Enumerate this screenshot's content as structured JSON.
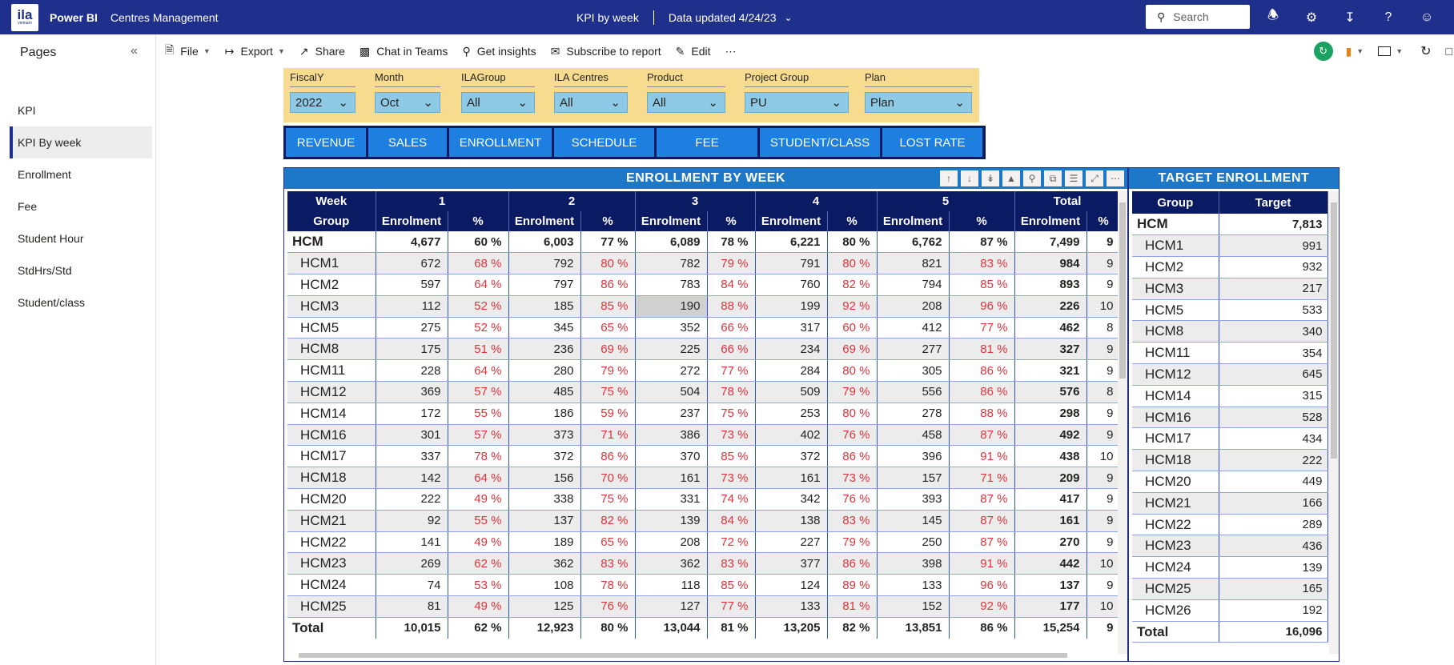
{
  "topbar": {
    "logo_text": "ila",
    "logo_sub": "vietnam",
    "brand": "Power BI",
    "workspace": "Centres Management",
    "report_title": "KPI by week",
    "data_updated": "Data updated 4/24/23",
    "search_placeholder": "Search"
  },
  "pages": {
    "title": "Pages",
    "items": [
      "KPI",
      "KPI By week",
      "Enrollment",
      "Fee",
      "Student Hour",
      "StdHrs/Std",
      "Student/class"
    ],
    "active_index": 1
  },
  "actions": {
    "file": "File",
    "export": "Export",
    "share": "Share",
    "chat": "Chat in Teams",
    "insights": "Get insights",
    "subscribe": "Subscribe to report",
    "edit": "Edit"
  },
  "slicers": [
    {
      "label": "FiscalY",
      "value": "2022"
    },
    {
      "label": "Month",
      "value": "Oct"
    },
    {
      "label": "ILAGroup",
      "value": "All"
    },
    {
      "label": "ILA Centres",
      "value": "All"
    },
    {
      "label": "Product",
      "value": "All"
    },
    {
      "label": "Project Group",
      "value": "PU"
    },
    {
      "label": "Plan",
      "value": "Plan"
    }
  ],
  "nav_buttons": [
    "REVENUE",
    "SALES",
    "ENROLLMENT",
    "SCHEDULE",
    "FEE",
    "STUDENT/CLASS",
    "LOST RATE"
  ],
  "enrollment": {
    "title": "ENROLLMENT BY WEEK",
    "week_label": "Week",
    "group_label": "Group",
    "weeks": [
      "1",
      "2",
      "3",
      "4",
      "5",
      "Total"
    ],
    "col_enrol": "Enrolment",
    "col_pct": "%",
    "rows": [
      {
        "g": "HCM",
        "v": [
          "4,677",
          "60 %",
          "6,003",
          "77 %",
          "6,089",
          "78 %",
          "6,221",
          "80 %",
          "6,762",
          "87 %",
          "7,499",
          "9"
        ]
      },
      {
        "g": "HCM1",
        "v": [
          "672",
          "68 %",
          "792",
          "80 %",
          "782",
          "79 %",
          "791",
          "80 %",
          "821",
          "83 %",
          "984",
          "9"
        ]
      },
      {
        "g": "HCM2",
        "v": [
          "597",
          "64 %",
          "797",
          "86 %",
          "783",
          "84 %",
          "760",
          "82 %",
          "794",
          "85 %",
          "893",
          "9"
        ]
      },
      {
        "g": "HCM3",
        "v": [
          "112",
          "52 %",
          "185",
          "85 %",
          "190",
          "88 %",
          "199",
          "92 %",
          "208",
          "96 %",
          "226",
          "10"
        ]
      },
      {
        "g": "HCM5",
        "v": [
          "275",
          "52 %",
          "345",
          "65 %",
          "352",
          "66 %",
          "317",
          "60 %",
          "412",
          "77 %",
          "462",
          "8"
        ]
      },
      {
        "g": "HCM8",
        "v": [
          "175",
          "51 %",
          "236",
          "69 %",
          "225",
          "66 %",
          "234",
          "69 %",
          "277",
          "81 %",
          "327",
          "9"
        ]
      },
      {
        "g": "HCM11",
        "v": [
          "228",
          "64 %",
          "280",
          "79 %",
          "272",
          "77 %",
          "284",
          "80 %",
          "305",
          "86 %",
          "321",
          "9"
        ]
      },
      {
        "g": "HCM12",
        "v": [
          "369",
          "57 %",
          "485",
          "75 %",
          "504",
          "78 %",
          "509",
          "79 %",
          "556",
          "86 %",
          "576",
          "8"
        ]
      },
      {
        "g": "HCM14",
        "v": [
          "172",
          "55 %",
          "186",
          "59 %",
          "237",
          "75 %",
          "253",
          "80 %",
          "278",
          "88 %",
          "298",
          "9"
        ]
      },
      {
        "g": "HCM16",
        "v": [
          "301",
          "57 %",
          "373",
          "71 %",
          "386",
          "73 %",
          "402",
          "76 %",
          "458",
          "87 %",
          "492",
          "9"
        ]
      },
      {
        "g": "HCM17",
        "v": [
          "337",
          "78 %",
          "372",
          "86 %",
          "370",
          "85 %",
          "372",
          "86 %",
          "396",
          "91 %",
          "438",
          "10"
        ]
      },
      {
        "g": "HCM18",
        "v": [
          "142",
          "64 %",
          "156",
          "70 %",
          "161",
          "73 %",
          "161",
          "73 %",
          "157",
          "71 %",
          "209",
          "9"
        ]
      },
      {
        "g": "HCM20",
        "v": [
          "222",
          "49 %",
          "338",
          "75 %",
          "331",
          "74 %",
          "342",
          "76 %",
          "393",
          "87 %",
          "417",
          "9"
        ]
      },
      {
        "g": "HCM21",
        "v": [
          "92",
          "55 %",
          "137",
          "82 %",
          "139",
          "84 %",
          "138",
          "83 %",
          "145",
          "87 %",
          "161",
          "9"
        ]
      },
      {
        "g": "HCM22",
        "v": [
          "141",
          "49 %",
          "189",
          "65 %",
          "208",
          "72 %",
          "227",
          "79 %",
          "250",
          "87 %",
          "270",
          "9"
        ]
      },
      {
        "g": "HCM23",
        "v": [
          "269",
          "62 %",
          "362",
          "83 %",
          "362",
          "83 %",
          "377",
          "86 %",
          "398",
          "91 %",
          "442",
          "10"
        ]
      },
      {
        "g": "HCM24",
        "v": [
          "74",
          "53 %",
          "108",
          "78 %",
          "118",
          "85 %",
          "124",
          "89 %",
          "133",
          "96 %",
          "137",
          "9"
        ]
      },
      {
        "g": "HCM25",
        "v": [
          "81",
          "49 %",
          "125",
          "76 %",
          "127",
          "77 %",
          "133",
          "81 %",
          "152",
          "92 %",
          "177",
          "10"
        ]
      }
    ],
    "total": {
      "g": "Total",
      "v": [
        "10,015",
        "62 %",
        "12,923",
        "80 %",
        "13,044",
        "81 %",
        "13,205",
        "82 %",
        "13,851",
        "86 %",
        "15,254",
        "9"
      ]
    }
  },
  "target": {
    "title": "TARGET ENROLLMENT",
    "group_label": "Group",
    "target_label": "Target",
    "rows": [
      {
        "g": "HCM",
        "t": "7,813"
      },
      {
        "g": "HCM1",
        "t": "991"
      },
      {
        "g": "HCM2",
        "t": "932"
      },
      {
        "g": "HCM3",
        "t": "217"
      },
      {
        "g": "HCM5",
        "t": "533"
      },
      {
        "g": "HCM8",
        "t": "340"
      },
      {
        "g": "HCM11",
        "t": "354"
      },
      {
        "g": "HCM12",
        "t": "645"
      },
      {
        "g": "HCM14",
        "t": "315"
      },
      {
        "g": "HCM16",
        "t": "528"
      },
      {
        "g": "HCM17",
        "t": "434"
      },
      {
        "g": "HCM18",
        "t": "222"
      },
      {
        "g": "HCM20",
        "t": "449"
      },
      {
        "g": "HCM21",
        "t": "166"
      },
      {
        "g": "HCM22",
        "t": "289"
      },
      {
        "g": "HCM23",
        "t": "436"
      },
      {
        "g": "HCM24",
        "t": "139"
      },
      {
        "g": "HCM25",
        "t": "165"
      },
      {
        "g": "HCM26",
        "t": "192"
      }
    ],
    "total": {
      "g": "Total",
      "t": "16,096"
    }
  }
}
